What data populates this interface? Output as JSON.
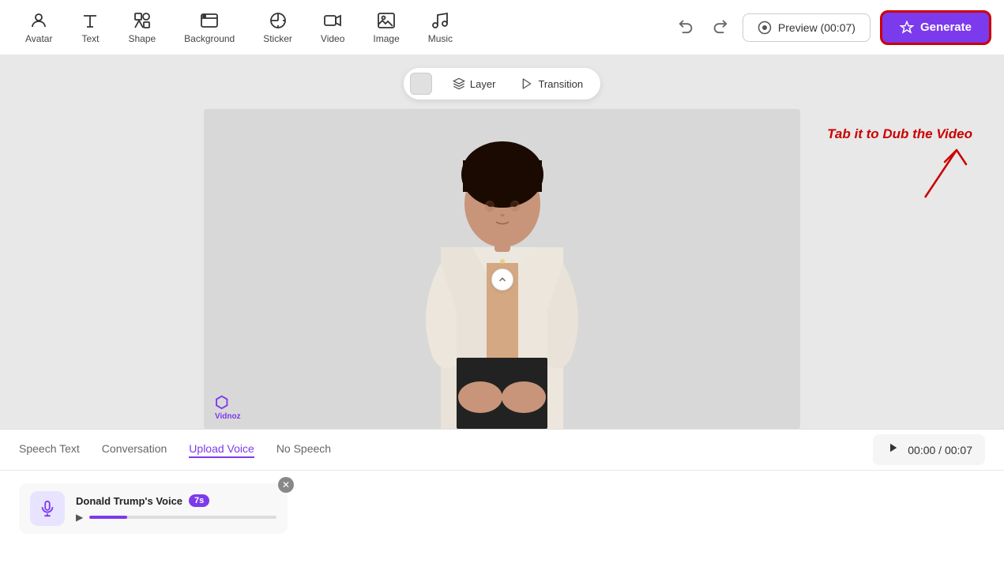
{
  "toolbar": {
    "items": [
      {
        "id": "avatar",
        "label": "Avatar",
        "icon": "👤"
      },
      {
        "id": "text",
        "label": "Text",
        "icon": "T"
      },
      {
        "id": "shape",
        "label": "Shape",
        "icon": "⬡"
      },
      {
        "id": "background",
        "label": "Background",
        "icon": "🖼"
      },
      {
        "id": "sticker",
        "label": "Sticker",
        "icon": "⭐"
      },
      {
        "id": "video",
        "label": "Video",
        "icon": "▶"
      },
      {
        "id": "image",
        "label": "Image",
        "icon": "🖼"
      },
      {
        "id": "music",
        "label": "Music",
        "icon": "♪"
      }
    ],
    "preview_label": "Preview (00:07)",
    "generate_label": "Generate"
  },
  "canvas": {
    "layer_label": "Layer",
    "transition_label": "Transition",
    "color_swatch": "#e0e0e0",
    "watermark_text": "Vidnoz"
  },
  "annotation": {
    "text": "Tab it to Dub the Video"
  },
  "bottom": {
    "tabs": [
      {
        "id": "speech-text",
        "label": "Speech Text",
        "active": false
      },
      {
        "id": "conversation",
        "label": "Conversation",
        "active": false
      },
      {
        "id": "upload-voice",
        "label": "Upload Voice",
        "active": true
      },
      {
        "id": "no-speech",
        "label": "No Speech",
        "active": false
      }
    ],
    "playback": {
      "time": "00:00 / 00:07"
    },
    "voice_item": {
      "name": "Donald Trump's Voice",
      "badge": "7s"
    }
  }
}
